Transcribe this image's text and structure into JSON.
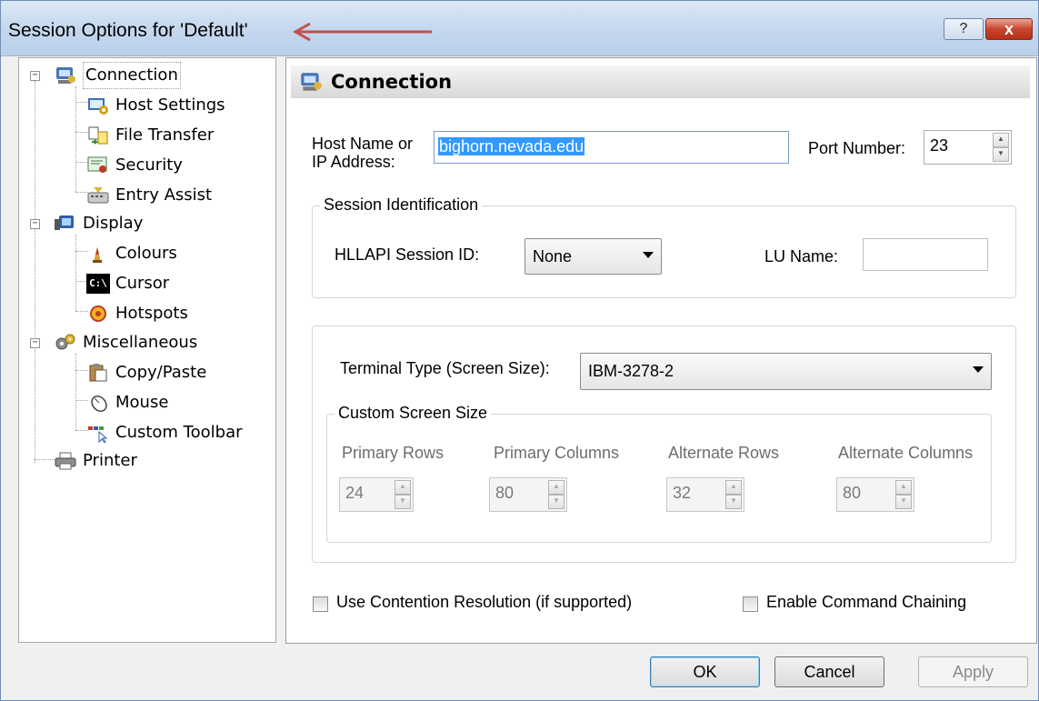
{
  "window": {
    "title": "Session Options for 'Default'",
    "help_label": "?",
    "close_label": "x"
  },
  "tree": {
    "items": [
      {
        "label": "Connection"
      },
      {
        "label": "Host Settings"
      },
      {
        "label": "File Transfer"
      },
      {
        "label": "Security"
      },
      {
        "label": "Entry Assist"
      },
      {
        "label": "Display"
      },
      {
        "label": "Colours"
      },
      {
        "label": "Cursor"
      },
      {
        "label": "Hotspots"
      },
      {
        "label": "Miscellaneous"
      },
      {
        "label": "Copy/Paste"
      },
      {
        "label": "Mouse"
      },
      {
        "label": "Custom Toolbar"
      },
      {
        "label": "Printer"
      }
    ],
    "cursor_icon_text": "C:\\"
  },
  "panel": {
    "title": "Connection",
    "host_label": "Host Name or\nIP Address:",
    "host_value": "bighorn.nevada.edu",
    "port_label": "Port Number:",
    "port_value": "23",
    "session_group": "Session Identification",
    "hllapi_label": "HLLAPI Session ID:",
    "hllapi_value": "None",
    "lu_label": "LU Name:",
    "lu_value": "",
    "terminal_label": "Terminal Type (Screen Size):",
    "terminal_value": "IBM-3278-2",
    "custom_group": "Custom Screen Size",
    "primary_rows_label": "Primary Rows",
    "primary_rows_value": "24",
    "primary_cols_label": "Primary Columns",
    "primary_cols_value": "80",
    "alt_rows_label": "Alternate Rows",
    "alt_rows_value": "32",
    "alt_cols_label": "Alternate Columns",
    "alt_cols_value": "80",
    "contention_label": "Use Contention Resolution (if supported)",
    "chaining_label": "Enable Command Chaining"
  },
  "buttons": {
    "ok": "OK",
    "cancel": "Cancel",
    "apply": "Apply"
  },
  "colors": {
    "annotation_arrow": "#c0504d",
    "selection": "#3399ff"
  }
}
